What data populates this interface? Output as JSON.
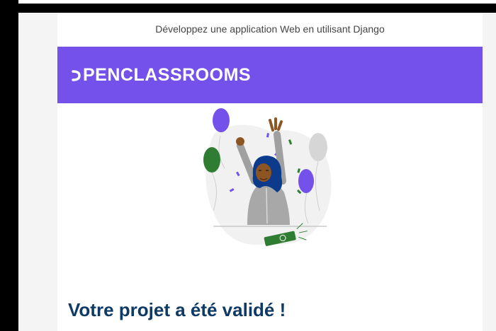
{
  "email": {
    "preheader": "Développez une application Web en utilisant Django",
    "brand": {
      "logo_text": "PENCLASSROOMS",
      "color": "#7451eb"
    },
    "headline": "Votre projet a été validé !",
    "colors": {
      "headline": "#103a66",
      "balloon_purple": "#7451eb",
      "balloon_green": "#2e7d32",
      "balloon_grey": "#d6d6d6",
      "phone_green": "#2e7d32"
    },
    "illustration": "celebration-illustration"
  }
}
